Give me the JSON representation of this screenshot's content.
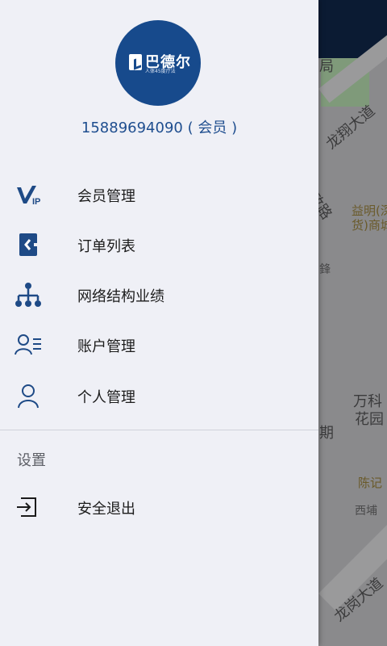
{
  "map": {
    "labels": [
      "局",
      "龙翔大道",
      "政路",
      "益明(深",
      "货)商城",
      "万科",
      "花园",
      "期",
      "陈记",
      "西埔",
      "龙岗大道",
      "鋒"
    ]
  },
  "drawer": {
    "logo": {
      "name": "巴德尔",
      "tagline": "人体45度疗法",
      "brand_color": "#174a8c"
    },
    "user": {
      "phone": "15889694090",
      "role": "( 会员 )"
    },
    "menu": [
      {
        "label": "会员管理",
        "icon": "vip-icon"
      },
      {
        "label": "订单列表",
        "icon": "order-list-icon"
      },
      {
        "label": "网络结构业绩",
        "icon": "network-structure-icon"
      },
      {
        "label": "账户管理",
        "icon": "account-list-icon"
      },
      {
        "label": "个人管理",
        "icon": "person-icon"
      }
    ],
    "settings": {
      "title": "设置",
      "logout": {
        "label": "安全退出",
        "icon": "logout-icon"
      }
    }
  }
}
